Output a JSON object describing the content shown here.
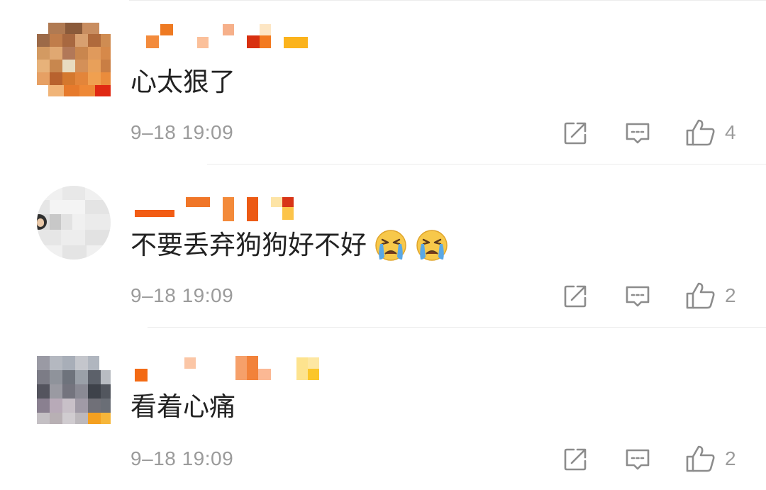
{
  "comments": [
    {
      "text": "心太狠了",
      "timestamp": "9–18 19:09",
      "like_count": "4",
      "emojis": [],
      "avatar_icon": "pixelated-avatar",
      "username_icon": "pixelated-username"
    },
    {
      "text": "不要丢弃狗狗好不好",
      "timestamp": "9–18 19:09",
      "like_count": "2",
      "emojis": [
        "crying-face-emoji",
        "crying-face-emoji"
      ],
      "avatar_icon": "pixelated-avatar",
      "username_icon": "pixelated-username"
    },
    {
      "text": "看着心痛",
      "timestamp": "9–18 19:09",
      "like_count": "2",
      "emojis": [],
      "avatar_icon": "pixelated-avatar",
      "username_icon": "pixelated-username"
    }
  ],
  "actions": {
    "repost_icon": "repost-icon",
    "comment_icon": "comment-icon",
    "like_icon": "thumbs-up-icon"
  },
  "colors": {
    "text": "#222222",
    "meta": "#9b9b9b",
    "divider": "#ececec",
    "emoji_face": "#f7c84a",
    "emoji_tears": "#5aa8e6"
  }
}
